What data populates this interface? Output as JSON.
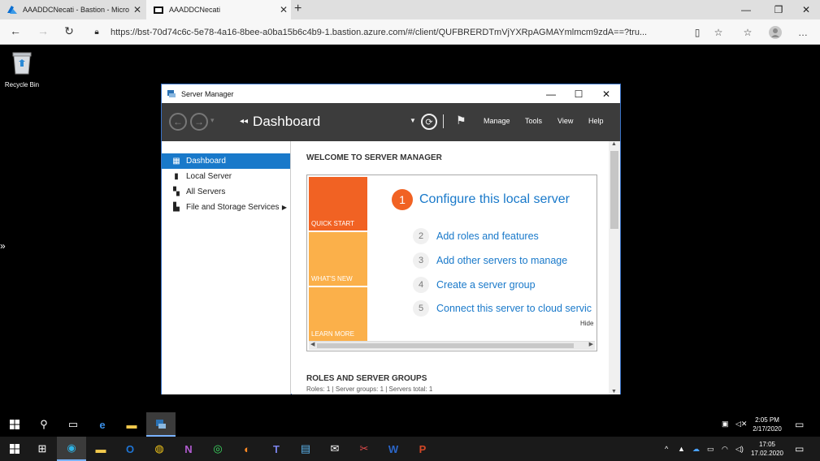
{
  "browser": {
    "tabs": [
      {
        "label": "AAADDCNecati - Bastion - Micro",
        "icon": "azure-icon"
      },
      {
        "label": "AAADDCNecati",
        "icon": "remote-desktop-icon"
      }
    ],
    "url": "https://bst-70d74c6c-5e78-4a16-8bee-a0ba15b6c4b9-1.bastion.azure.com/#/client/QUFBRERDTmVjYXRpAGMAYmlmcm9zdA==?tru..."
  },
  "desktop": {
    "recycle_bin_label": "Recycle Bin"
  },
  "server_manager": {
    "title": "Server Manager",
    "breadcrumb": "Dashboard",
    "menu": [
      "Manage",
      "Tools",
      "View",
      "Help"
    ],
    "nav": [
      {
        "label": "Dashboard",
        "icon": "dashboard-icon",
        "active": true
      },
      {
        "label": "Local Server",
        "icon": "local-server-icon",
        "active": false
      },
      {
        "label": "All Servers",
        "icon": "all-servers-icon",
        "active": false
      },
      {
        "label": "File and Storage Services",
        "icon": "file-storage-icon",
        "active": false
      }
    ],
    "welcome_heading": "WELCOME TO SERVER MANAGER",
    "tiles": [
      "QUICK START",
      "WHAT'S NEW",
      "LEARN MORE"
    ],
    "steps": [
      {
        "num": "1",
        "label": "Configure this local server"
      },
      {
        "num": "2",
        "label": "Add roles and features"
      },
      {
        "num": "3",
        "label": "Add other servers to manage"
      },
      {
        "num": "4",
        "label": "Create a server group"
      },
      {
        "num": "5",
        "label": "Connect this server to cloud servic"
      }
    ],
    "hide_label": "Hide",
    "roles_heading": "ROLES AND SERVER GROUPS",
    "roles_summary": "Roles: 1   |   Server groups: 1   |   Servers total: 1"
  },
  "remote_taskbar": {
    "time": "2:05 PM",
    "date": "2/17/2020"
  },
  "local_taskbar": {
    "time": "17:05",
    "date": "17.02.2020"
  },
  "colors": {
    "accent": "#1979ca",
    "quick_start": "#f16223",
    "tile_light": "#fbb04a"
  }
}
